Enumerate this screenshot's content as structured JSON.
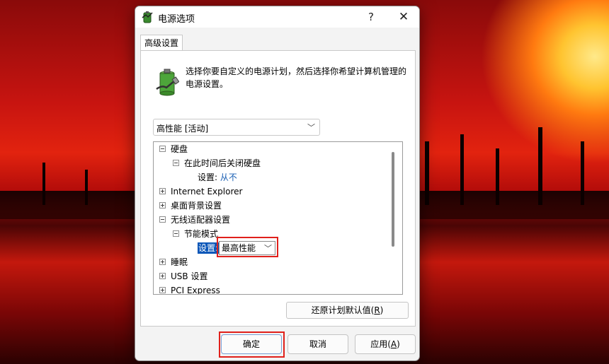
{
  "window": {
    "title": "电源选项",
    "help_glyph": "?",
    "close_glyph": "✕"
  },
  "tab": {
    "label": "高级设置"
  },
  "description": "选择你要自定义的电源计划，然后选择你希望计算机管理的电源设置。",
  "plan_select": {
    "value": "高性能 [活动]"
  },
  "tree": {
    "hard_disk": "硬盘",
    "turn_off_disk": "在此时间后关闭硬盘",
    "setting_label": "设置:",
    "never": "从不",
    "ie": "Internet Explorer",
    "desktop_bg": "桌面背景设置",
    "wireless": "无线适配器设置",
    "power_saving_mode": "节能模式",
    "setting_label_selected": "设置:",
    "power_saving_value": "最高性能",
    "sleep": "睡眠",
    "usb": "USB 设置",
    "pci": "PCI Express"
  },
  "buttons": {
    "restore": "还原计划默认值(",
    "restore_key": "R",
    "restore_end": ")",
    "ok": "确定",
    "cancel": "取消",
    "apply": "应用(",
    "apply_key": "A",
    "apply_end": ")"
  },
  "colors": {
    "highlight_box": "#e0201b",
    "selection": "#0a56b8",
    "link": "#1a5fb4"
  }
}
